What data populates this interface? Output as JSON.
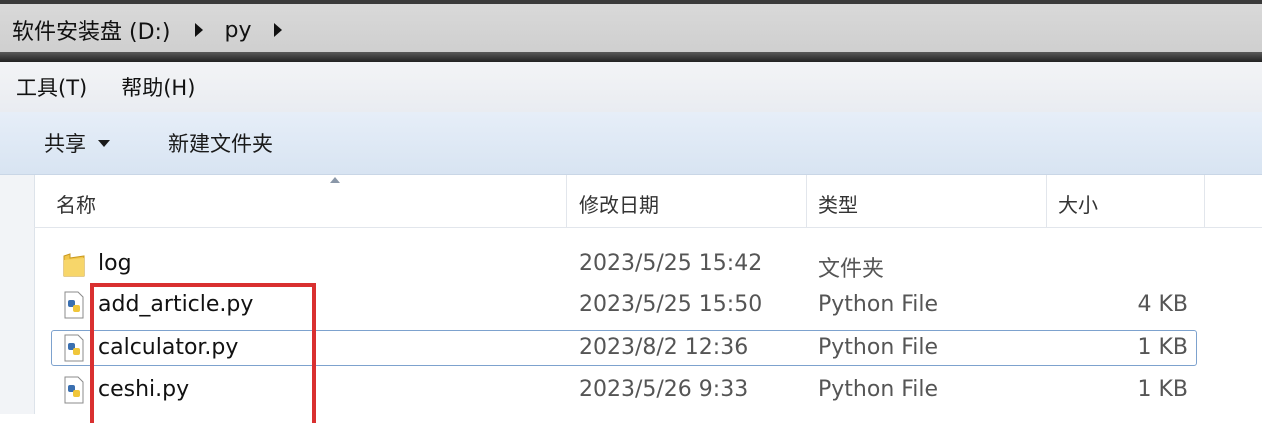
{
  "address": {
    "crumbs": [
      "软件安装盘 (D:)",
      "py"
    ]
  },
  "menu": {
    "items": [
      "工具(T)",
      "帮助(H)"
    ]
  },
  "toolbar": {
    "share_label": "共享",
    "new_folder_label": "新建文件夹"
  },
  "table": {
    "headers": {
      "name": "名称",
      "date": "修改日期",
      "type": "类型",
      "size": "大小"
    },
    "rows": [
      {
        "icon": "folder-icon",
        "name": "log",
        "date": "2023/5/25 15:42",
        "type": "文件夹",
        "size": ""
      },
      {
        "icon": "python-file-icon",
        "name": "add_article.py",
        "date": "2023/5/25 15:50",
        "type": "Python File",
        "size": "4 KB"
      },
      {
        "icon": "python-file-icon",
        "name": "calculator.py",
        "date": "2023/8/2 12:36",
        "type": "Python File",
        "size": "1 KB"
      },
      {
        "icon": "python-file-icon",
        "name": "ceshi.py",
        "date": "2023/5/26 9:33",
        "type": "Python File",
        "size": "1 KB"
      }
    ]
  },
  "colors": {
    "highlight": "#d93030",
    "toolbar": "#dde7f4",
    "focus": "#7da2ce"
  }
}
